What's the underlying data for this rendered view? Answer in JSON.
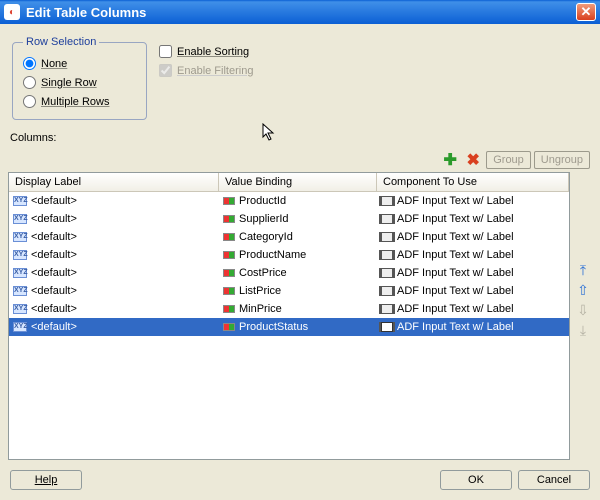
{
  "title": "Edit Table Columns",
  "row_selection": {
    "legend": "Row Selection",
    "options": [
      "None",
      "Single Row",
      "Multiple Rows"
    ],
    "selected": "None"
  },
  "checks": {
    "sorting": {
      "label": "Enable Sorting",
      "checked": false,
      "enabled": true
    },
    "filtering": {
      "label": "Enable Filtering",
      "checked": true,
      "enabled": false
    }
  },
  "columns_label": "Columns:",
  "toolbar": {
    "group": "Group",
    "ungroup": "Ungroup"
  },
  "headers": {
    "display": "Display Label",
    "binding": "Value Binding",
    "component": "Component To Use"
  },
  "rows": [
    {
      "display": "<default>",
      "binding": "ProductId",
      "component": "ADF Input Text w/ Label",
      "selected": false
    },
    {
      "display": "<default>",
      "binding": "SupplierId",
      "component": "ADF Input Text w/ Label",
      "selected": false
    },
    {
      "display": "<default>",
      "binding": "CategoryId",
      "component": "ADF Input Text w/ Label",
      "selected": false
    },
    {
      "display": "<default>",
      "binding": "ProductName",
      "component": "ADF Input Text w/ Label",
      "selected": false
    },
    {
      "display": "<default>",
      "binding": "CostPrice",
      "component": "ADF Input Text w/ Label",
      "selected": false
    },
    {
      "display": "<default>",
      "binding": "ListPrice",
      "component": "ADF Input Text w/ Label",
      "selected": false
    },
    {
      "display": "<default>",
      "binding": "MinPrice",
      "component": "ADF Input Text w/ Label",
      "selected": false
    },
    {
      "display": "<default>",
      "binding": "ProductStatus",
      "component": "ADF Input Text w/ Label",
      "selected": true
    }
  ],
  "buttons": {
    "help": "Help",
    "ok": "OK",
    "cancel": "Cancel"
  }
}
